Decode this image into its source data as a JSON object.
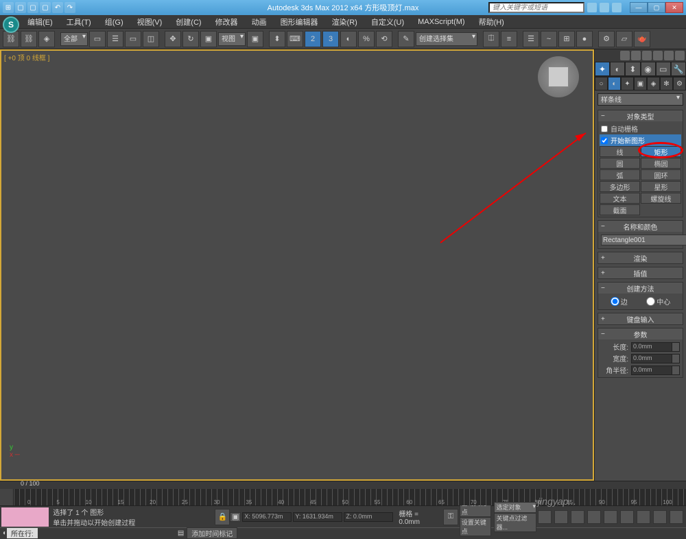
{
  "title": "Autodesk 3ds Max 2012 x64    方形吸顶灯.max",
  "search_placeholder": "键入关键字或短语",
  "menus": [
    "编辑(E)",
    "工具(T)",
    "组(G)",
    "视图(V)",
    "创建(C)",
    "修改器",
    "动画",
    "图形编辑器",
    "渲染(R)",
    "自定义(U)",
    "MAXScript(M)",
    "帮助(H)"
  ],
  "toolbar_all": "全部",
  "toolbar_view": "视图",
  "toolbar_sel_filter": "创建选择集",
  "viewport_label": "[ +0 顶 0 线框 ]",
  "timeline_label": "0 / 100",
  "timeline_ticks": [
    "0",
    "5",
    "10",
    "15",
    "20",
    "25",
    "30",
    "35",
    "40",
    "45",
    "50",
    "55",
    "60",
    "65",
    "70",
    "75",
    "80",
    "85",
    "90",
    "95",
    "100"
  ],
  "status_line1": "选择了 1 个 图形",
  "status_line2": "单击并拖动以开始创建过程",
  "coord_x": "X: 5096.773m",
  "coord_y": "Y: 1631.934m",
  "coord_z": "Z: 0.0mm",
  "grid_label": "栅格 = 0.0mm",
  "auto_key": "自动关键点",
  "sel_obj": "选定对象",
  "set_key": "设置关键点",
  "key_filter": "关键点过滤器...",
  "add_marker": "添加时间标记",
  "prompt_tag": "所在行:",
  "watermark": "jingyap...",
  "panel": {
    "category": "样条线",
    "rollouts": {
      "obj_type": "对象类型",
      "auto_grid": "自动栅格",
      "start_new": "开始新图形",
      "name_color": "名称和颜色",
      "render": "渲染",
      "interp": "插值",
      "create_method": "创建方法",
      "kbd": "键盘输入",
      "params": "参数"
    },
    "shapes": {
      "line": "线",
      "rect": "矩形",
      "circle": "圆",
      "ellipse": "椭圆",
      "arc": "弧",
      "donut": "圆环",
      "ngon": "多边形",
      "star": "星形",
      "text": "文本",
      "helix": "螺旋线",
      "section": "截面"
    },
    "obj_name": "Rectangle001",
    "method_edge": "边",
    "method_center": "中心",
    "params_len": "长度:",
    "params_wid": "宽度:",
    "params_rad": "角半径:",
    "zero": "0.0mm"
  }
}
